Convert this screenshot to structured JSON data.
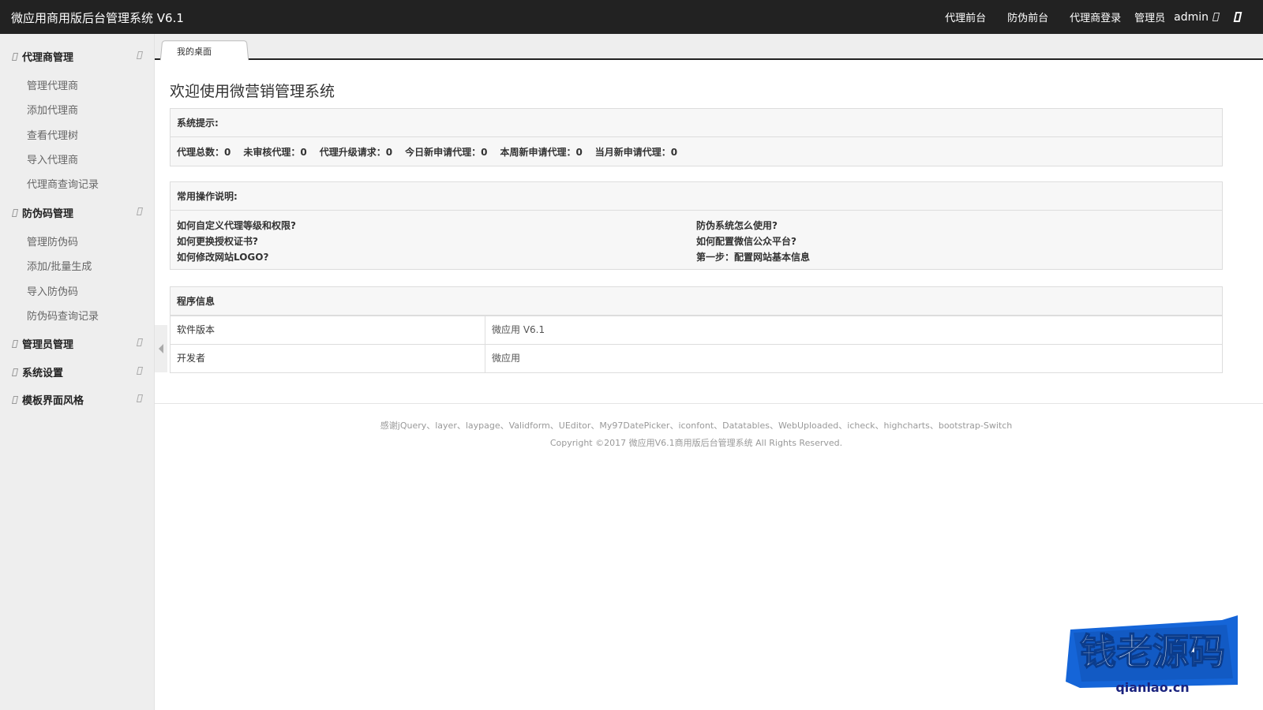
{
  "app": {
    "title": "微应用商用版后台管理系统 V6.1"
  },
  "topnav": {
    "links": [
      "代理前台",
      "防伪前台",
      "代理商登录"
    ],
    "role": "管理员",
    "username": "admin"
  },
  "sidebar": {
    "groups": [
      {
        "title": "代理商管理",
        "items": [
          "管理代理商",
          "添加代理商",
          "查看代理树",
          "导入代理商",
          "代理商查询记录"
        ]
      },
      {
        "title": "防伪码管理",
        "items": [
          "管理防伪码",
          "添加/批量生成",
          "导入防伪码",
          "防伪码查询记录"
        ]
      },
      {
        "title": "管理员管理",
        "items": []
      },
      {
        "title": "系统设置",
        "items": []
      },
      {
        "title": "模板界面风格",
        "items": []
      }
    ]
  },
  "tabs": {
    "active": "我的桌面"
  },
  "main": {
    "welcome": "欢迎使用微营销管理系统",
    "system_notice": {
      "title": "系统提示:",
      "stats": [
        "代理总数：0",
        "未审核代理：0",
        "代理升级请求：0",
        "今日新申请代理：0",
        "本周新申请代理：0",
        "当月新申请代理：0"
      ]
    },
    "help": {
      "title": "常用操作说明:",
      "left": [
        "如何自定义代理等级和权限?",
        "如何更换授权证书?",
        "如何修改网站LOGO?"
      ],
      "right": [
        "防伪系统怎么使用?",
        "如何配置微信公众平台?",
        "第一步：配置网站基本信息"
      ]
    },
    "program_info": {
      "title": "程序信息",
      "rows": [
        {
          "label": "软件版本",
          "value": "微应用 V6.1"
        },
        {
          "label": "开发者",
          "value": "微应用"
        }
      ]
    }
  },
  "footer": {
    "thanks": "感谢jQuery、layer、laypage、Validform、UEditor、My97DatePicker、iconfont、Datatables、WebUploaded、icheck、highcharts、bootstrap-Switch",
    "copyright": "Copyright ©2017 微应用V6.1商用版后台管理系统 All Rights Reserved."
  },
  "watermark": {
    "text": "钱老源码",
    "domain": "qianlao.cn"
  },
  "colors": {
    "topbar_bg": "#222222",
    "sidebar_bg": "#eeeeee",
    "panel_head_bg": "#f7f7f7",
    "watermark_blue": "#1565d8"
  }
}
